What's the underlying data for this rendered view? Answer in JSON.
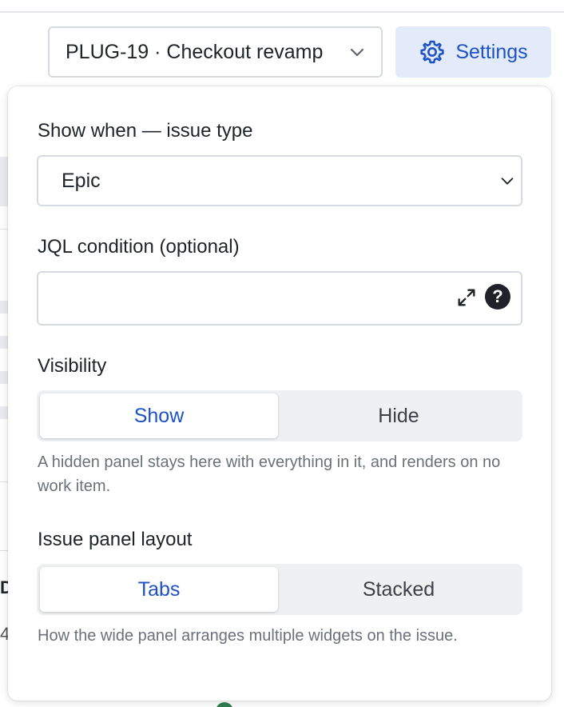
{
  "header": {
    "project_select": {
      "value": "PLUG-19 · Checkout revamp",
      "icon": "chevron-down-icon"
    },
    "settings_button": {
      "label": "Settings",
      "icon": "gear-icon",
      "color": "#1d52c7",
      "background": "#e3ebfb"
    }
  },
  "background": {
    "letter_1": "D",
    "letter_2": "4"
  },
  "panel": {
    "issue_type": {
      "label": "Show when — issue type",
      "value": "Epic"
    },
    "jql": {
      "label": "JQL condition (optional)",
      "value": "",
      "placeholder": ""
    },
    "visibility": {
      "label": "Visibility",
      "options": [
        "Show",
        "Hide"
      ],
      "selected": "Show",
      "helper": "A hidden panel stays here with everything in it, and renders on no work item."
    },
    "layout": {
      "label": "Issue panel layout",
      "options": [
        "Tabs",
        "Stacked"
      ],
      "selected": "Tabs",
      "helper": "How the wide panel arranges multiple widgets on the issue."
    }
  },
  "colors": {
    "accent": "#1d52c7",
    "segment_track": "#eff0f2",
    "border": "#d7dade",
    "helper_text": "#6b7079"
  }
}
